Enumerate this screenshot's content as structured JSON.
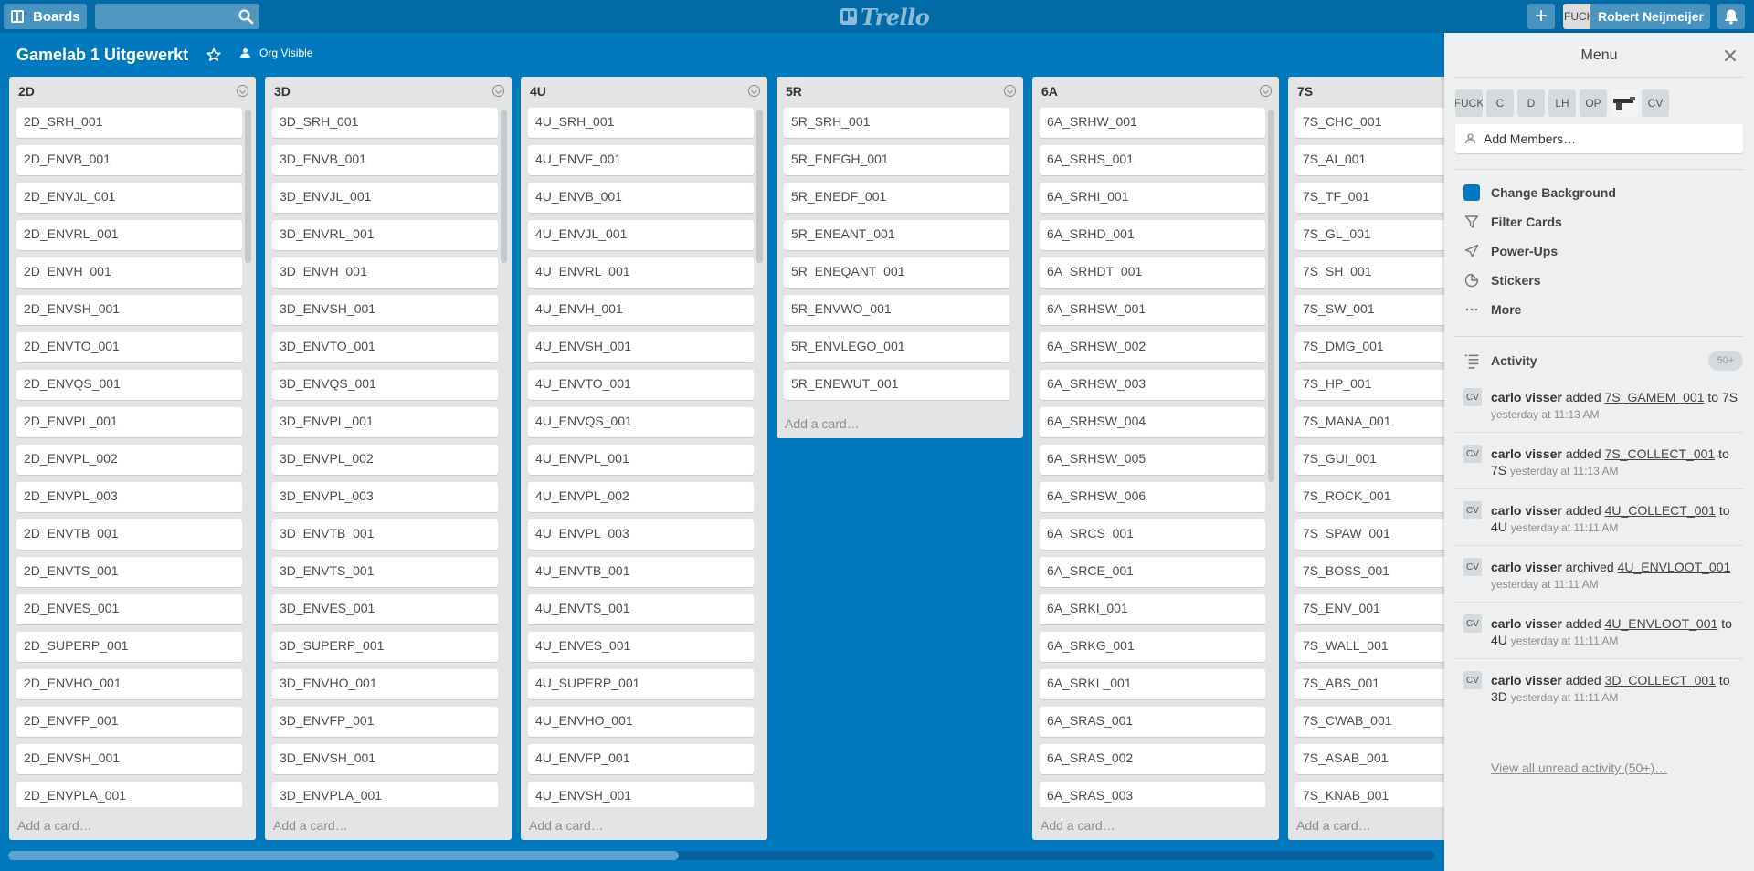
{
  "header": {
    "boards_label": "Boards",
    "search_value": "",
    "logo_text": "Trello",
    "add_label": "+",
    "avatar_text": "FUCK",
    "user_name": "Robert Neijmeijer"
  },
  "board": {
    "title": "Gamelab 1 Uitgewerkt",
    "visibility": "Org Visible"
  },
  "lists": [
    {
      "name": "2D",
      "cards": [
        "2D_SRH_001",
        "2D_ENVB_001",
        "2D_ENVJL_001",
        "2D_ENVRL_001",
        "2D_ENVH_001",
        "2D_ENVSH_001",
        "2D_ENVTO_001",
        "2D_ENVQS_001",
        "2D_ENVPL_001",
        "2D_ENVPL_002",
        "2D_ENVPL_003",
        "2D_ENVTB_001",
        "2D_ENVTS_001",
        "2D_ENVES_001",
        "2D_SUPERP_001",
        "2D_ENVHO_001",
        "2D_ENVFP_001",
        "2D_ENVSH_001",
        "2D_ENVPLA_001"
      ],
      "add_card": "Add a card…"
    },
    {
      "name": "3D",
      "cards": [
        "3D_SRH_001",
        "3D_ENVB_001",
        "3D_ENVJL_001",
        "3D_ENVRL_001",
        "3D_ENVH_001",
        "3D_ENVSH_001",
        "3D_ENVTO_001",
        "3D_ENVQS_001",
        "3D_ENVPL_001",
        "3D_ENVPL_002",
        "3D_ENVPL_003",
        "3D_ENVTB_001",
        "3D_ENVTS_001",
        "3D_ENVES_001",
        "3D_SUPERP_001",
        "3D_ENVHO_001",
        "3D_ENVFP_001",
        "3D_ENVSH_001",
        "3D_ENVPLA_001"
      ],
      "add_card": "Add a card…"
    },
    {
      "name": "4U",
      "cards": [
        "4U_SRH_001",
        "4U_ENVF_001",
        "4U_ENVB_001",
        "4U_ENVJL_001",
        "4U_ENVRL_001",
        "4U_ENVH_001",
        "4U_ENVSH_001",
        "4U_ENVTO_001",
        "4U_ENVQS_001",
        "4U_ENVPL_001",
        "4U_ENVPL_002",
        "4U_ENVPL_003",
        "4U_ENVTB_001",
        "4U_ENVTS_001",
        "4U_ENVES_001",
        "4U_SUPERP_001",
        "4U_ENVHO_001",
        "4U_ENVFP_001",
        "4U_ENVSH_001"
      ],
      "add_card": "Add a card…"
    },
    {
      "name": "5R",
      "cards": [
        "5R_SRH_001",
        "5R_ENEGH_001",
        "5R_ENEDF_001",
        "5R_ENEANT_001",
        "5R_ENEQANT_001",
        "5R_ENVWO_001",
        "5R_ENVLEGO_001",
        "5R_ENEWUT_001"
      ],
      "add_card": "Add a card…"
    },
    {
      "name": "6A",
      "cards": [
        "6A_SRHW_001",
        "6A_SRHS_001",
        "6A_SRHI_001",
        "6A_SRHD_001",
        "6A_SRHDT_001",
        "6A_SRHSW_001",
        "6A_SRHSW_002",
        "6A_SRHSW_003",
        "6A_SRHSW_004",
        "6A_SRHSW_005",
        "6A_SRHSW_006",
        "6A_SRCS_001",
        "6A_SRCE_001",
        "6A_SRKI_001",
        "6A_SRKG_001",
        "6A_SRKL_001",
        "6A_SRAS_001",
        "6A_SRAS_002",
        "6A_SRAS_003"
      ],
      "add_card": "Add a card…"
    },
    {
      "name": "7S",
      "cards": [
        "7S_CHC_001",
        "7S_AI_001",
        "7S_TF_001",
        "7S_GL_001",
        "7S_SH_001",
        "7S_SW_001",
        "7S_DMG_001",
        "7S_HP_001",
        "7S_MANA_001",
        "7S_GUI_001",
        "7S_ROCK_001",
        "7S_SPAW_001",
        "7S_BOSS_001",
        "7S_ENV_001",
        "7S_WALL_001",
        "7S_ABS_001",
        "7S_CWAB_001",
        "7S_ASAB_001",
        "7S_KNAB_001"
      ],
      "add_card": "Add a card…"
    }
  ],
  "sidebar": {
    "title": "Menu",
    "members": [
      "FUCK",
      "C",
      "D",
      "LH",
      "OP",
      "",
      "CV"
    ],
    "add_members": "Add Members…",
    "items": [
      {
        "label": "Change Background",
        "icon": "background-swatch-icon"
      },
      {
        "label": "Filter Cards",
        "icon": "filter-icon"
      },
      {
        "label": "Power-Ups",
        "icon": "rocket-icon"
      },
      {
        "label": "Stickers",
        "icon": "sticker-icon"
      },
      {
        "label": "More",
        "icon": "more-icon"
      }
    ],
    "activity_label": "Activity",
    "activity_count": "50+",
    "activities": [
      {
        "initials": "CV",
        "user": "carlo visser",
        "verb": "added",
        "card": "7S_GAMEM_001",
        "prep": "to",
        "list": "7S",
        "time": "yesterday at 11:13 AM"
      },
      {
        "initials": "CV",
        "user": "carlo visser",
        "verb": "added",
        "card": "7S_COLLECT_001",
        "prep": "to",
        "list": "7S",
        "time": "yesterday at 11:13 AM"
      },
      {
        "initials": "CV",
        "user": "carlo visser",
        "verb": "added",
        "card": "4U_COLLECT_001",
        "prep": "to",
        "list": "4U",
        "time": "yesterday at 11:11 AM"
      },
      {
        "initials": "CV",
        "user": "carlo visser",
        "verb": "archived",
        "card": "4U_ENVLOOT_001",
        "prep": "",
        "list": "",
        "time": "yesterday at 11:11 AM"
      },
      {
        "initials": "CV",
        "user": "carlo visser",
        "verb": "added",
        "card": "4U_ENVLOOT_001",
        "prep": "to",
        "list": "4U",
        "time": "yesterday at 11:11 AM"
      },
      {
        "initials": "CV",
        "user": "carlo visser",
        "verb": "added",
        "card": "3D_COLLECT_001",
        "prep": "to",
        "list": "3D",
        "time": "yesterday at 11:11 AM"
      }
    ],
    "view_all": "View all unread activity (50+)…"
  },
  "colors": {
    "board_background": "#0079bf",
    "header_background": "#026aa7",
    "list_background": "#e2e4e6",
    "sidebar_background": "#edeff0"
  }
}
